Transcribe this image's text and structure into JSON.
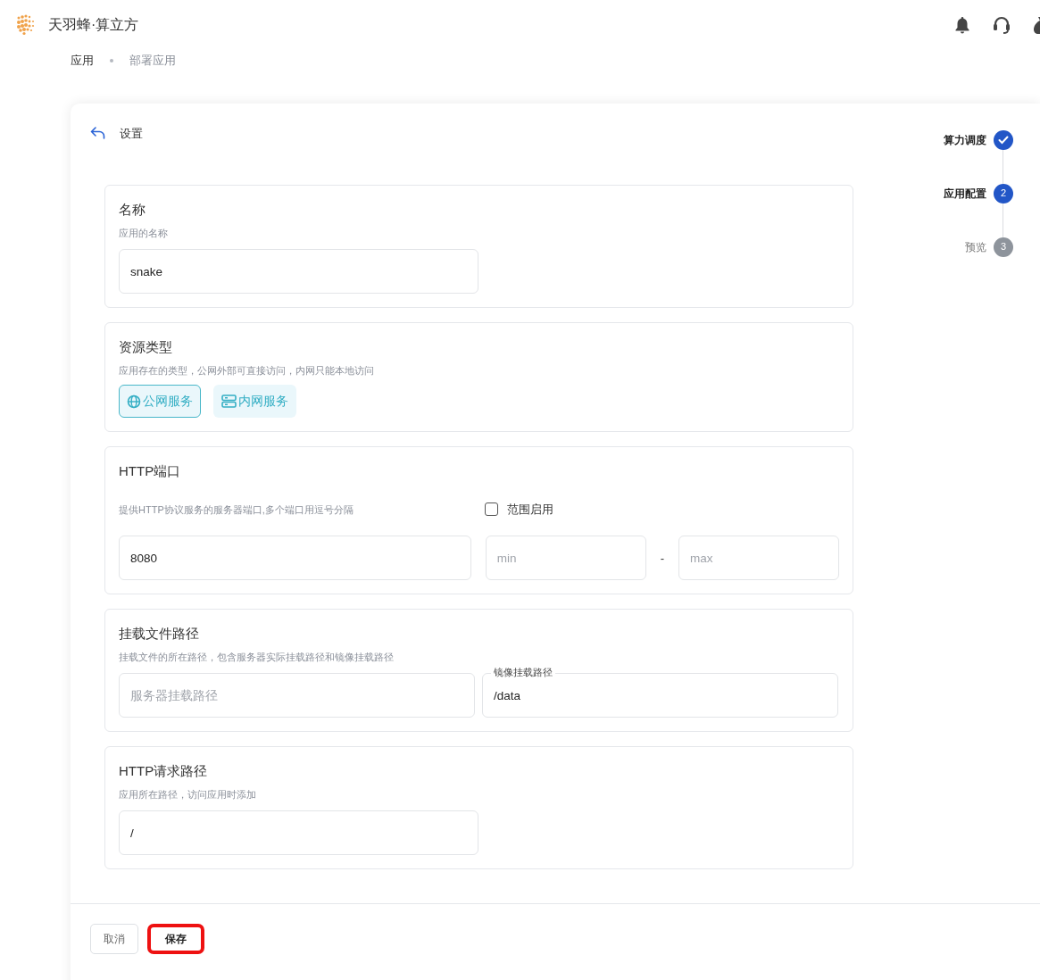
{
  "header": {
    "brand": "天羽蜂·算立方"
  },
  "breadcrumb": [
    {
      "label": "应用",
      "current": false
    },
    {
      "label": "部署应用",
      "current": true
    }
  ],
  "card": {
    "title": "设置"
  },
  "steps": [
    {
      "label": "算力调度",
      "completed": true
    },
    {
      "label": "应用配置",
      "completed": false,
      "current": true,
      "number": "2"
    },
    {
      "label": "预览",
      "completed": false,
      "current": false,
      "number": "3"
    }
  ],
  "sections": [
    {
      "kind": "text",
      "title": "名称",
      "hint": "应用的名称",
      "value": "snake"
    },
    {
      "kind": "choice",
      "title": "资源类型",
      "hint": "应用存在的类型，公网外部可直接访问，内网只能本地访问",
      "options": [
        {
          "kind": "public",
          "label": "公网服务",
          "selected": true
        },
        {
          "kind": "internal",
          "label": "内网服务",
          "selected": false
        }
      ]
    },
    {
      "kind": "port",
      "title": "HTTP端口",
      "hint": "提供HTTP协议服务的服务器端口,多个端口用逗号分隔",
      "range_label": "范围启用",
      "range_checked": false,
      "value": "8080",
      "min_placeholder": "min",
      "separator": "-",
      "max_placeholder": "max"
    },
    {
      "kind": "mount",
      "title": "挂载文件路径",
      "hint": "挂载文件的所在路径，包含服务器实际挂载路径和镜像挂载路径",
      "fields": [
        {
          "placeholder": "服务器挂载路径"
        },
        {
          "label": "镜像挂载路径",
          "value": "/data"
        }
      ]
    },
    {
      "kind": "text",
      "title": "HTTP请求路径",
      "hint": "应用所在路径，访问应用时添加",
      "value": "/"
    }
  ],
  "buttons": [
    {
      "kind": "secondary",
      "label": "取消",
      "highlighted": false
    },
    {
      "kind": "primary",
      "label": "保存",
      "highlighted": true
    }
  ]
}
